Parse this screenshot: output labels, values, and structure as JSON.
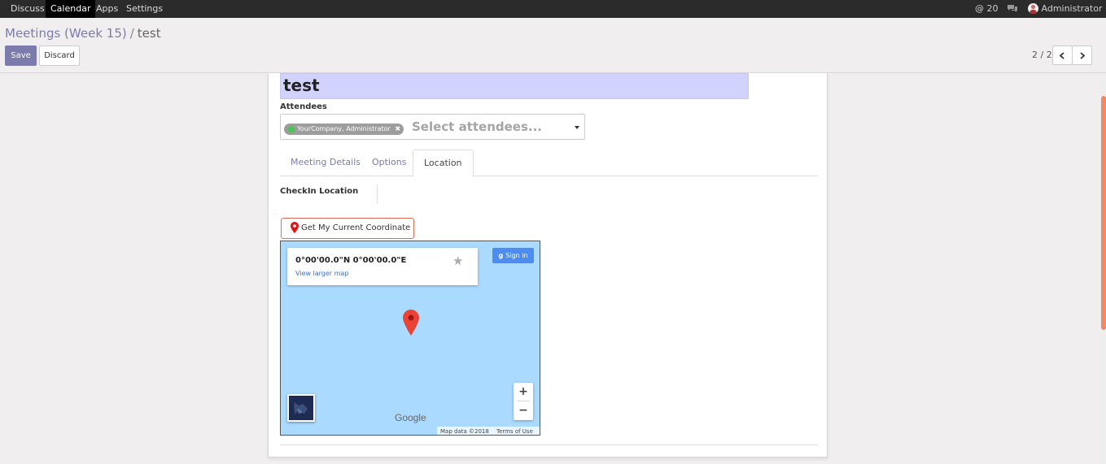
{
  "nav": {
    "items": [
      "Discuss",
      "Calendar",
      "Apps",
      "Settings"
    ],
    "activity_count": "20",
    "user": "Administrator"
  },
  "breadcrumb": {
    "parent": "Meetings (Week 15)",
    "separator": "/",
    "current": "test"
  },
  "buttons": {
    "save": "Save",
    "discard": "Discard"
  },
  "pager": {
    "text": "2 / 2"
  },
  "form": {
    "title": "test",
    "attendees_label": "Attendees",
    "attendee_tag": "YourCompany, Administrator",
    "attendees_placeholder": "Select attendees...",
    "tabs": [
      "Meeting Details",
      "Options",
      "Location"
    ],
    "active_tab": "Location",
    "checkin_label": "CheckIn Location",
    "coord_button": "Get My Current Coordinate"
  },
  "map": {
    "coordinates": "0°00'00.0\"N 0°00'00.0\"E",
    "larger_map": "View larger map",
    "sign_in": "Sign in",
    "zoom_in": "+",
    "zoom_out": "−",
    "logo": "Google",
    "map_data": "Map data ©2018",
    "terms": "Terms of Use"
  },
  "colors": {
    "accent": "#7c7bad",
    "nav_bg": "#2b2b2b",
    "title_bg": "#d2d2ff",
    "map_water": "#aadaff",
    "pin": "#ea4335"
  }
}
